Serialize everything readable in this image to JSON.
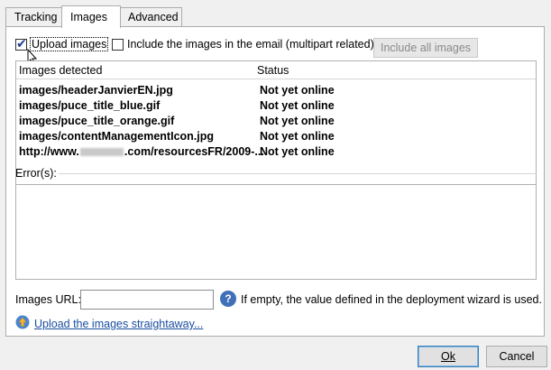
{
  "tabs": [
    {
      "label": "Tracking"
    },
    {
      "label": "Images"
    },
    {
      "label": "Advanced"
    }
  ],
  "options": {
    "upload_images": {
      "label": "Upload images",
      "checked": true
    },
    "include_images": {
      "label": "Include the images in the email (multipart related)",
      "checked": false
    },
    "include_all_button": "Include all images"
  },
  "images_list": {
    "columns": [
      "Images detected",
      "Status"
    ],
    "rows": [
      {
        "image": "images/headerJanvierEN.jpg",
        "status": "Not yet online"
      },
      {
        "image": "images/puce_title_blue.gif",
        "status": "Not yet online"
      },
      {
        "image": "images/puce_title_orange.gif",
        "status": "Not yet online"
      },
      {
        "image": "images/contentManagementIcon.jpg",
        "status": "Not yet online"
      },
      {
        "image_prefix": "http://www.",
        "image_suffix": ".com/resourcesFR/2009-...",
        "status": "Not yet online"
      }
    ]
  },
  "errors": {
    "label": "Error(s):"
  },
  "images_url": {
    "label": "Images URL:",
    "value": "",
    "hint": "If empty, the value defined in the deployment wizard is used."
  },
  "upload_link": "Upload the images straightaway...",
  "buttons": {
    "ok": "Ok",
    "cancel": "Cancel"
  },
  "colors": {
    "link": "#1a4ea0",
    "help_icon": "#3f70b8",
    "default_button_border": "#3c7fb1"
  }
}
